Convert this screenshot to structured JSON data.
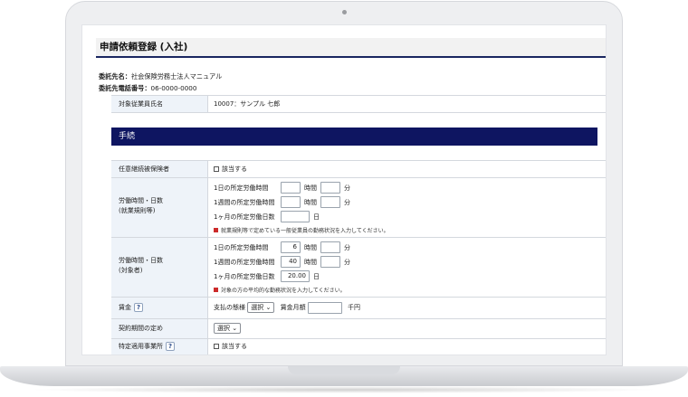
{
  "page": {
    "title": "申請依頼登録 (入社)",
    "client_name_label": "委託先名：",
    "client_name": "社会保険労務士法人マニュアル",
    "client_phone_label": "委託先電話番号：",
    "client_phone": "06-0000-0000"
  },
  "employee": {
    "label": "対象従業員氏名",
    "value": "10007：サンプル 七郎"
  },
  "section_title": "手続",
  "form": {
    "optional_insurance": {
      "label": "任意継続被保険者",
      "checkbox_label": "該当する"
    },
    "work_rules": {
      "label_line1": "労働時間・日数",
      "label_line2": "(就業規則等)",
      "daily_label": "1日の所定労働時間",
      "daily_hours": "",
      "daily_minutes": "",
      "weekly_label": "1週間の所定労働時間",
      "weekly_hours": "",
      "weekly_minutes": "",
      "monthly_label": "1ヶ月の所定労働日数",
      "monthly_days": "",
      "hours_unit": "時間",
      "minutes_unit": "分",
      "days_unit": "日",
      "note": "就業規則等で定めている一般従業員の勤務状況を入力してください。"
    },
    "work_actual": {
      "label_line1": "労働時間・日数",
      "label_line2": "(対象者)",
      "daily_label": "1日の所定労働時間",
      "daily_hours": "6",
      "daily_minutes": "",
      "weekly_label": "1週間の所定労働時間",
      "weekly_hours": "40",
      "weekly_minutes": "",
      "monthly_label": "1ヶ月の所定労働日数",
      "monthly_days": "20.00",
      "hours_unit": "時間",
      "minutes_unit": "分",
      "days_unit": "日",
      "note": "対象の方の平均的な勤務状況を入力してください。"
    },
    "wage": {
      "label": "賃金",
      "help": "?",
      "payment_label": "支払の態様",
      "payment_select": "選択",
      "amount_label": "賃金月額",
      "amount_value": "",
      "amount_unit": "千円"
    },
    "contract_period": {
      "label": "契約期間の定め",
      "select": "選択"
    },
    "specific_office": {
      "label": "特定適用事業所",
      "help": "?",
      "checkbox_label": "該当する"
    }
  }
}
